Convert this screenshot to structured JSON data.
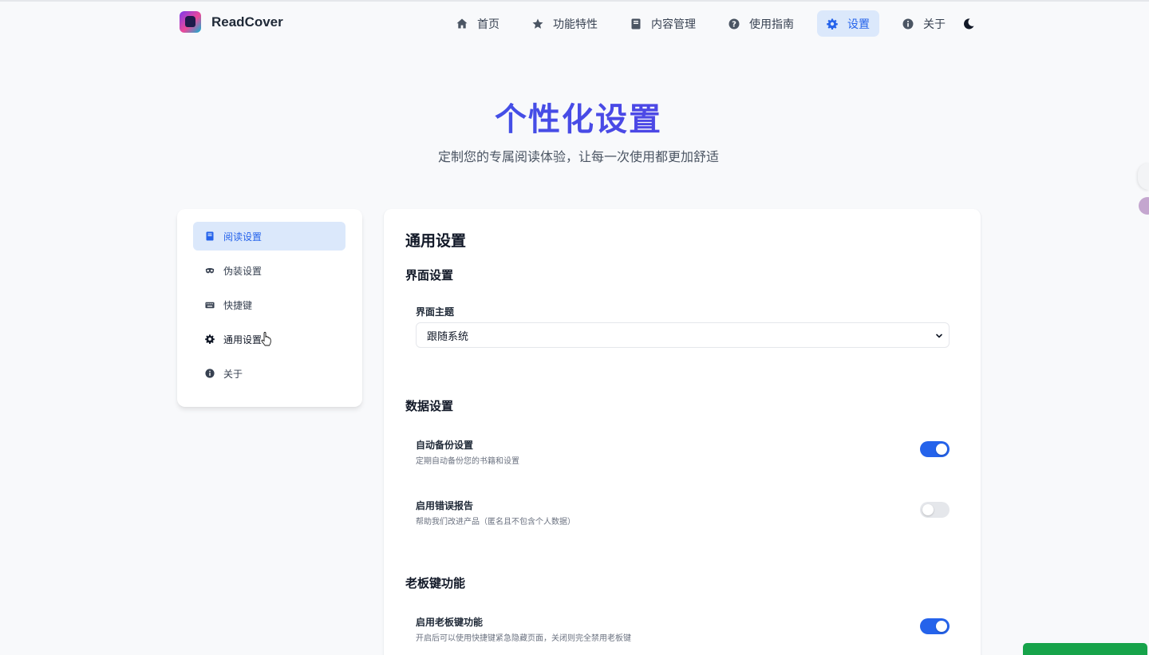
{
  "brand": {
    "name": "ReadCover"
  },
  "nav": {
    "items": [
      {
        "label": "首页",
        "icon": "home-icon"
      },
      {
        "label": "功能特性",
        "icon": "star-icon"
      },
      {
        "label": "内容管理",
        "icon": "book-icon"
      },
      {
        "label": "使用指南",
        "icon": "question-circle-icon"
      },
      {
        "label": "设置",
        "icon": "gear-icon",
        "active": true
      },
      {
        "label": "关于",
        "icon": "info-circle-icon"
      }
    ],
    "theme_icon": "moon-icon"
  },
  "hero": {
    "title": "个性化设置",
    "subtitle": "定制您的专属阅读体验，让每一次使用都更加舒适"
  },
  "sidebar": {
    "items": [
      {
        "label": "阅读设置",
        "icon": "book-icon",
        "active": true
      },
      {
        "label": "伪装设置",
        "icon": "mask-icon"
      },
      {
        "label": "快捷键",
        "icon": "keyboard-icon"
      },
      {
        "label": "通用设置",
        "icon": "gear-icon"
      },
      {
        "label": "关于",
        "icon": "info-circle-icon"
      }
    ]
  },
  "main": {
    "title": "通用设置",
    "interface": {
      "section": "界面设置",
      "theme_label": "界面主题",
      "theme_value": "跟随系统"
    },
    "data": {
      "section": "数据设置",
      "options": [
        {
          "title": "自动备份设置",
          "desc": "定期自动备份您的书籍和设置",
          "enabled": true
        },
        {
          "title": "启用错误报告",
          "desc": "帮助我们改进产品（匿名且不包含个人数据）",
          "enabled": false
        }
      ]
    },
    "boss": {
      "section": "老板键功能",
      "options": [
        {
          "title": "启用老板键功能",
          "desc": "开启后可以使用快捷键紧急隐藏页面，关闭则完全禁用老板键",
          "enabled": true
        }
      ]
    }
  },
  "colors": {
    "accent": "#2563eb",
    "active_bg": "#dbe8fb",
    "toggle_off": "#e5e7eb"
  }
}
